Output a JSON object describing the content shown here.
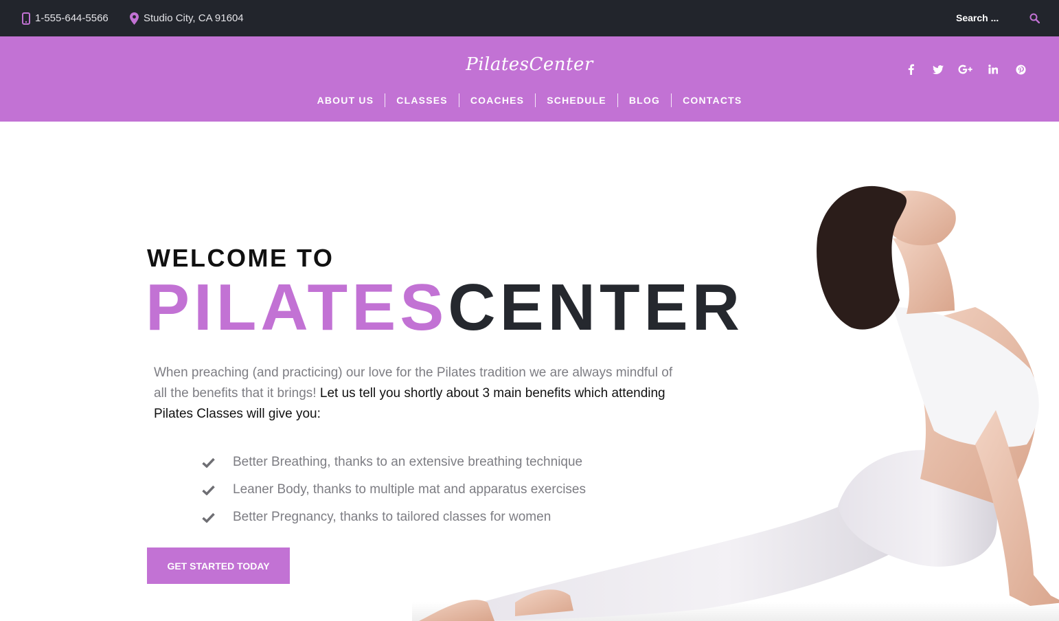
{
  "topbar": {
    "phone": "1-555-644-5566",
    "address": "Studio City, CA 91604",
    "search_placeholder": "Search ...",
    "accent_color": "#c272d4"
  },
  "header": {
    "logo": "PilatesCenter",
    "nav": [
      "ABOUT US",
      "CLASSES",
      "COACHES",
      "SCHEDULE",
      "BLOG",
      "CONTACTS"
    ],
    "social_icons": [
      "facebook-icon",
      "twitter-icon",
      "google-plus-icon",
      "linkedin-icon",
      "pinterest-icon"
    ],
    "background_color": "#c272d4"
  },
  "hero": {
    "welcome": "WELCOME TO",
    "title_part1": "PILATES",
    "title_part2": "CENTER",
    "intro_plain": "When preaching (and practicing) our love for the Pilates tradition we are always mindful of all the benefits that it brings! ",
    "intro_strong": "Let us tell you shortly about 3 main benefits which attending Pilates Classes will give you:",
    "benefits": [
      "Better Breathing, thanks to an extensive breathing technique",
      "Leaner Body, thanks to multiple mat and apparatus exercises",
      "Better Pregnancy, thanks to tailored classes for women"
    ],
    "cta": "GET STARTED TODAY"
  }
}
